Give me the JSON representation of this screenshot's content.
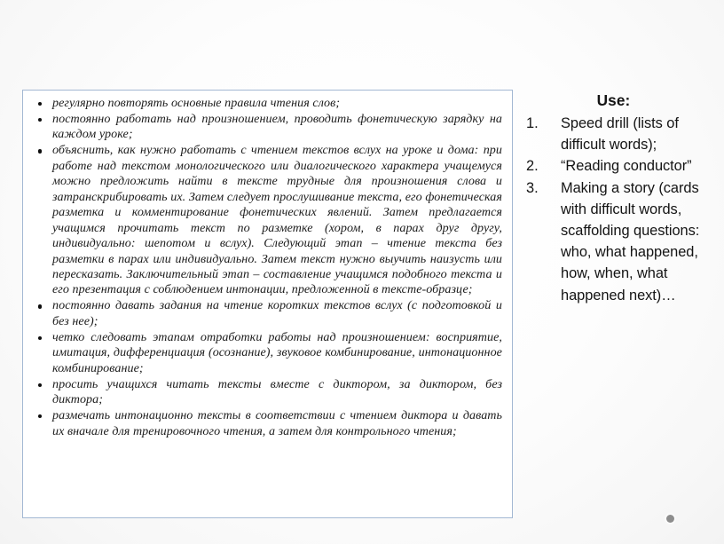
{
  "slide": {
    "background_color": "#f2f2f2",
    "accent_border_color": "#a3b8d3"
  },
  "russian_textbox": {
    "bullets": [
      "регулярно повторять основные правила чтения слов;",
      "постоянно работать над произношением, проводить фонетическую зарядку на каждом уроке;",
      "объяснить, как нужно работать с чтением текстов вслух на уроке и дома: при работе над текстом монологического или диалогического характера учащемуся можно предложить найти в тексте трудные для произношения слова и затранскрибировать их. Затем следует прослушивание текста, его фонетическая разметка и комментирование фонетических явлений. Затем предлагается учащимся прочитать текст по разметке (хором, в парах друг другу, индивидуально: шепотом и вслух). Следующий этап – чтение текста без разметки в парах или индивидуально. Затем текст нужно выучить наизусть или пересказать. Заключительный этап – составление учащимся подобного текста и его презентация с соблюдением интонации, предложенной в тексте-образце;",
      "постоянно давать задания на чтение коротких текстов вслух (с подготовкой и без нее);",
      "четко следовать этапам отработки работы над произношением: восприятие, имитация, дифференциация (осознание), звуковое комбинирование, интонационное комбинирование;",
      "просить учащихся читать тексты вместе с диктором, за диктором, без диктора;",
      "размечать интонационно тексты в соответствии с чтением диктора и давать их вначале для тренировочного чтения, а затем для контрольного чтения;"
    ]
  },
  "english_panel": {
    "heading": "Use:",
    "items": [
      "Speed drill (lists of difficult words);",
      "“Reading conductor”",
      "Making a story (cards with difficult words, scaffolding questions: who, what happened, how, when, what happened next)…"
    ]
  }
}
